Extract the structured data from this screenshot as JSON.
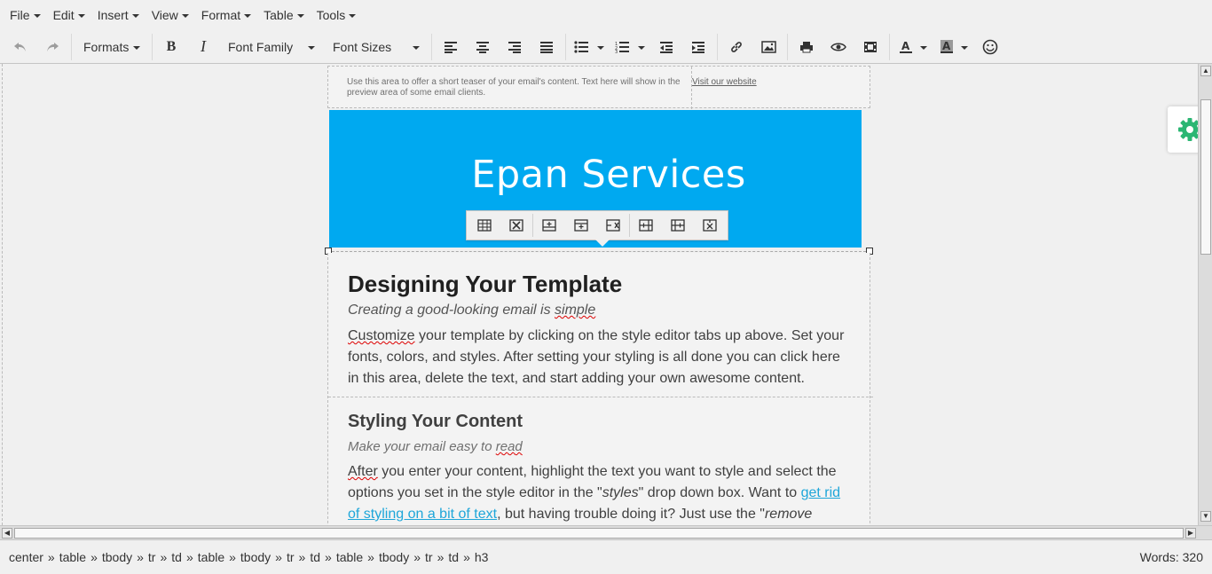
{
  "menubar": {
    "items": [
      {
        "label": "File"
      },
      {
        "label": "Edit"
      },
      {
        "label": "Insert"
      },
      {
        "label": "View"
      },
      {
        "label": "Format"
      },
      {
        "label": "Table"
      },
      {
        "label": "Tools"
      }
    ]
  },
  "toolbar": {
    "formats_label": "Formats",
    "font_family_label": "Font Family",
    "font_sizes_label": "Font Sizes",
    "icons": [
      "undo-icon",
      "redo-icon",
      "bold-icon",
      "italic-icon",
      "align-left-icon",
      "align-center-icon",
      "align-right-icon",
      "align-justify-icon",
      "bullet-list-icon",
      "numbered-list-icon",
      "outdent-icon",
      "indent-icon",
      "link-icon",
      "image-icon",
      "print-icon",
      "preview-icon",
      "media-icon",
      "text-color-icon",
      "background-color-icon",
      "emoticons-icon"
    ]
  },
  "email": {
    "preheader_text": "Use this area to offer a short teaser of your email's content. Text here will show in the preview area of some email clients.",
    "preheader_link": "Visit our website",
    "header_title": "Epan Services",
    "heading1": "Designing Your Template",
    "subheading1": {
      "pre": "Creating a good-looking email is ",
      "misspelled": "simple"
    },
    "para1": {
      "misspelled": "Customize",
      "rest": " your template by clicking on the style editor tabs up above. Set your fonts, colors, and styles. After setting your styling is all done you can click here in this area, delete the text, and start adding your own awesome content."
    },
    "heading2": "Styling Your Content",
    "subheading2": {
      "pre": "Make your email easy to ",
      "misspelled": "read"
    },
    "para2": {
      "misspelled": "After",
      "part1": " you enter your content, highlight the text you want to style and select the options you set in the style editor in the \"",
      "styles_word": "styles",
      "part2": "\" drop down box. Want to ",
      "link": "get rid of styling on a bit of text",
      "part3": ", but having trouble doing it? Just use the \"",
      "remove_word": "remove"
    }
  },
  "table_popup": {
    "icons": [
      "table-props-icon",
      "delete-table-icon",
      "insert-row-before-icon",
      "insert-row-after-icon",
      "delete-row-icon",
      "insert-col-before-icon",
      "insert-col-after-icon",
      "delete-col-icon"
    ]
  },
  "statusbar": {
    "path": [
      "center",
      "table",
      "tbody",
      "tr",
      "td",
      "table",
      "tbody",
      "tr",
      "td",
      "table",
      "tbody",
      "tr",
      "td",
      "h3"
    ],
    "separator": "»",
    "word_count": "Words: 320"
  },
  "colors": {
    "header_bg": "#00a9f0",
    "gear": "#2bb673",
    "link": "#1ea6d9"
  }
}
